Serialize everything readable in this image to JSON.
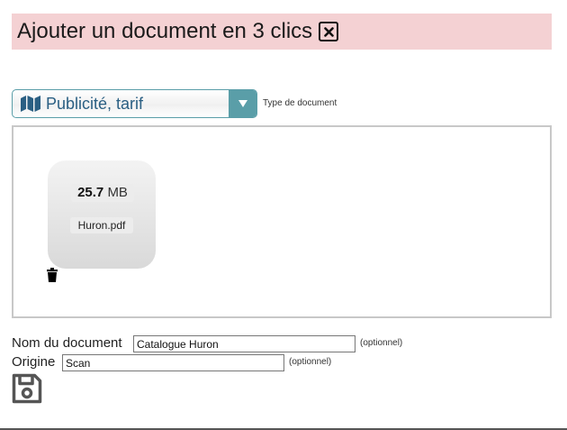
{
  "header": {
    "title": "Ajouter un document en 3 clics",
    "close_icon": "close-icon"
  },
  "document_type": {
    "selected": "Publicité, tarif",
    "icon": "map-icon",
    "label": "Type de document"
  },
  "file": {
    "size_value": "25.7",
    "size_unit": "MB",
    "name": "Huron.pdf",
    "delete_icon": "trash-icon"
  },
  "form": {
    "name_label": "Nom du document",
    "name_value": "Catalogue Huron",
    "name_optional": "(optionnel)",
    "origin_label": "Origine",
    "origin_value": "Scan",
    "origin_optional": "(optionnel)",
    "save_icon": "floppy-disk-icon"
  },
  "colors": {
    "header_bg": "#f4d1d3",
    "select_accent": "#5a9ea8",
    "select_text": "#2a5f83"
  }
}
